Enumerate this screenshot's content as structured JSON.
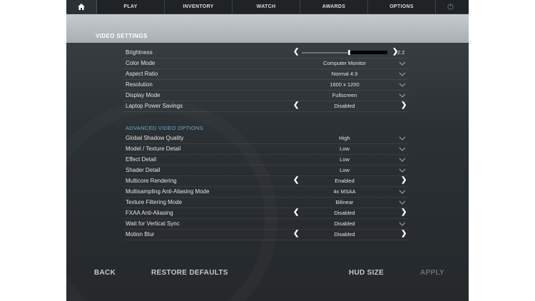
{
  "nav": {
    "tabs": [
      "PLAY",
      "INVENTORY",
      "WATCH",
      "AWARDS",
      "OPTIONS"
    ]
  },
  "section_title": "VIDEO SETTINGS",
  "brightness": {
    "label": "Brightness",
    "value": "2.2",
    "level": 0.55
  },
  "settings": [
    {
      "label": "Color Mode",
      "value": "Computer Monitor",
      "control": "dropdown"
    },
    {
      "label": "Aspect Ratio",
      "value": "Normal 4:3",
      "control": "dropdown"
    },
    {
      "label": "Resolution",
      "value": "1600 x 1200",
      "control": "dropdown"
    },
    {
      "label": "Display Mode",
      "value": "Fullscreen",
      "control": "dropdown"
    },
    {
      "label": "Laptop Power Savings",
      "value": "Disabled",
      "control": "toggle"
    }
  ],
  "advanced_title": "ADVANCED VIDEO OPTIONS",
  "advanced": [
    {
      "label": "Global Shadow Quality",
      "value": "High",
      "control": "dropdown"
    },
    {
      "label": "Model / Texture Detail",
      "value": "Low",
      "control": "dropdown"
    },
    {
      "label": "Effect Detail",
      "value": "Low",
      "control": "dropdown"
    },
    {
      "label": "Shader Detail",
      "value": "Low",
      "control": "dropdown"
    },
    {
      "label": "Multicore Rendering",
      "value": "Enabled",
      "control": "toggle"
    },
    {
      "label": "Multisampling Anti-Aliasing Mode",
      "value": "4x MSAA",
      "control": "dropdown"
    },
    {
      "label": "Texture Filtering Mode",
      "value": "Bilinear",
      "control": "dropdown"
    },
    {
      "label": "FXAA Anti-Aliasing",
      "value": "Disabled",
      "control": "toggle"
    },
    {
      "label": "Wait for Vertical Sync",
      "value": "Disabled",
      "control": "dropdown"
    },
    {
      "label": "Motion Blur",
      "value": "Disabled",
      "control": "toggle"
    }
  ],
  "footer": {
    "back": "BACK",
    "restore": "RESTORE DEFAULTS",
    "hud_size": "HUD SIZE",
    "apply": "APPLY"
  }
}
